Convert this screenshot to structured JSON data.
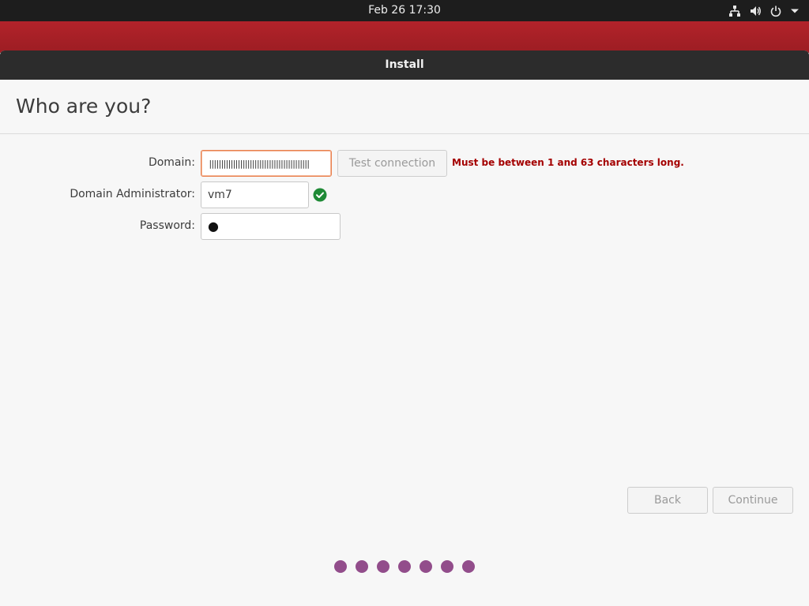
{
  "topbar": {
    "datetime": "Feb 26  17:30",
    "icons": [
      "network-icon",
      "volume-icon",
      "power-icon",
      "chevron-down-icon"
    ]
  },
  "window": {
    "title": "Install",
    "heading": "Who are you?"
  },
  "form": {
    "domain": {
      "label": "Domain:",
      "value": "||||||||||||||||||||||||||||||||||||||||||",
      "error": "Must be between 1 and 63 characters long."
    },
    "test_connection_label": "Test connection",
    "admin": {
      "label": "Domain Administrator:",
      "value": "vm7"
    },
    "password": {
      "label": "Password:",
      "value": "●"
    }
  },
  "buttons": {
    "back": "Back",
    "continue": "Continue"
  },
  "progress": {
    "steps": 7
  },
  "colors": {
    "accent": "#924d8b",
    "error": "#a40000",
    "ok": "#1f8a36",
    "focus_border": "#e9814f"
  }
}
